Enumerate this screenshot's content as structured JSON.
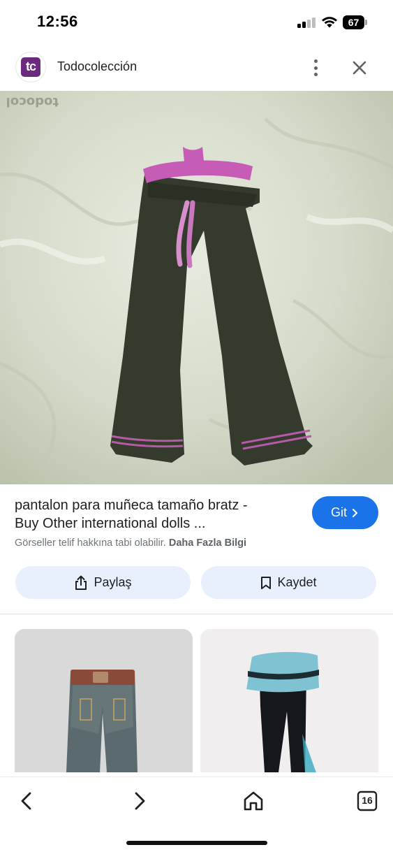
{
  "status_bar": {
    "time": "12:56",
    "battery_level": "67"
  },
  "site": {
    "logo_text": "tc",
    "name": "Todocolección",
    "logo_color": "#6b2a7d"
  },
  "main_image": {
    "watermark": "todocol"
  },
  "result": {
    "title_line1": "pantalon para muñeca tamaño bratz -",
    "title_line2": "Buy Other international dolls ...",
    "visit_label": "Git",
    "copyright_notice": "Görseller telif hakkına tabi olabilir.",
    "more_info_link": "Daha Fazla Bilgi"
  },
  "actions": {
    "share_label": "Paylaş",
    "save_label": "Kaydet"
  },
  "related": {
    "thumbnails": [
      "denim-pants-thumbnail",
      "black-pants-blue-skirt-thumbnail"
    ]
  },
  "toolbar": {
    "tab_count": "16"
  },
  "colors": {
    "accent": "#1a73e8",
    "chip_background": "#e8f0fe"
  }
}
